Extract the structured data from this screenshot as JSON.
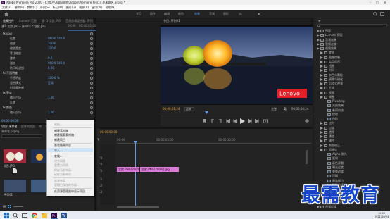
{
  "window": {
    "title": "Adobe Premiere Pro 2020 - C:\\用户\\Adm\\文档\\Adobe\\Premiere Pro\\14.0\\未命名.prproj *"
  },
  "menu": [
    "文件(F)",
    "编辑(E)",
    "剪辑(C)",
    "序列(S)",
    "标记(M)",
    "图形(G)",
    "视图(V)",
    "窗口(W)",
    "帮助(H)"
  ],
  "workspaces": [
    "学习",
    "组件",
    "编辑",
    "颜色",
    "效果",
    "音频",
    "图形",
    "库"
  ],
  "workspace_active": "效果",
  "effect_controls": {
    "tabs": [
      "效果控件",
      "Lumetri 范围",
      "源: 1-北欧.JPG",
      "音频剪辑混合器: 序列01"
    ],
    "clip": "源 * 北欧.JPG ▸ 序列01 * 北欧.JPG",
    "ruler": [
      "00:00",
      "00:00:05:00"
    ],
    "rows": [
      {
        "label": "fx 运动",
        "value": ""
      },
      {
        "label": "位置",
        "value": "960.0 540.0"
      },
      {
        "label": "缩放",
        "value": "100.0"
      },
      {
        "label": "缩放宽度",
        "value": "100.0"
      },
      {
        "label": "等比缩放",
        "value": ""
      },
      {
        "label": "旋转",
        "value": "0.0"
      },
      {
        "label": "锚点",
        "value": "960.0 540.0"
      },
      {
        "label": "防闪烁滤镜",
        "value": "0.00"
      },
      {
        "label": "fx 不透明度",
        "value": ""
      },
      {
        "label": "不透明度",
        "value": "100.0 %"
      },
      {
        "label": "混合模式",
        "value": "正常"
      },
      {
        "label": "时间重映射",
        "value": ""
      },
      {
        "label": "fx 亮度",
        "value": ""
      },
      {
        "label": "输入白场",
        "value": "1.00"
      },
      {
        "label": "反转",
        "value": ""
      },
      {
        "label": "fx 颜色",
        "value": ""
      },
      {
        "label": "输入白场",
        "value": "1.00"
      }
    ],
    "checkbox_label": "等比缩放",
    "timecode": "00:00:00:00"
  },
  "program_monitor": {
    "tab": "节目: 序列01",
    "brand": "Lenovo",
    "timecode_left": "00;00;01;24",
    "fit": "适合",
    "quality": "完整",
    "timecode_right": "00;00;04;24"
  },
  "project": {
    "tabs": [
      "项目: 未命名",
      "媒体浏览器",
      "库",
      "信息"
    ],
    "file": "未命名.prproj",
    "items": [
      "北欧.JPG",
      "序列01"
    ]
  },
  "context_menu": {
    "items": [
      {
        "label": "粘贴",
        "disabled": true
      },
      {
        "label": "新建素材箱",
        "disabled": false
      },
      {
        "label": "新建搜索素材箱",
        "disabled": false
      },
      {
        "label": "新建项目",
        "disabled": false
      },
      {
        "label": "查看隐藏内容",
        "disabled": false
      },
      {
        "label": "导入...",
        "disabled": false,
        "highlighted": true
      },
      {
        "label": "查找...",
        "disabled": false
      },
      {
        "label": "对齐网格",
        "disabled": true
      },
      {
        "label": "重置为网格",
        "disabled": true
      },
      {
        "label": "保存当前布局",
        "disabled": true
      },
      {
        "label": "另存为新布局...",
        "disabled": true
      },
      {
        "label": "恢复布局",
        "disabled": true
      },
      {
        "label": "管理已保存的布局...",
        "disabled": true
      },
      {
        "label": "在资源管理器中显示项目",
        "disabled": false
      }
    ]
  },
  "timeline": {
    "ruler": [
      "00:00",
      "00:00:05:00",
      "00:00:10:00"
    ],
    "timecode": "00:00:00:00",
    "clips": [
      "北欧.PNG[200%]",
      "北欧.PNG[200%].jpg"
    ],
    "tracks": [
      "V3",
      "V2",
      "V1",
      "A1",
      "A2",
      "A3"
    ]
  },
  "effects": {
    "tree": [
      {
        "label": "预设",
        "level": 0
      },
      {
        "label": "Lumetri 预设",
        "level": 0
      },
      {
        "label": "音频效果",
        "level": 0
      },
      {
        "label": "音频过渡",
        "level": 0
      },
      {
        "label": "视频效果",
        "level": 0
      },
      {
        "label": "变换",
        "level": 1
      },
      {
        "label": "图像控制",
        "level": 1
      },
      {
        "label": "实用程序",
        "level": 1
      },
      {
        "label": "扭曲",
        "level": 1
      },
      {
        "label": "时间",
        "level": 1
      },
      {
        "label": "杂色与颗粒",
        "level": 1
      },
      {
        "label": "模糊与锐化",
        "level": 1
      },
      {
        "label": "沉浸式视频",
        "level": 1
      },
      {
        "label": "生成",
        "level": 1
      },
      {
        "label": "视频",
        "level": 1
      },
      {
        "label": "调整",
        "level": 1
      },
      {
        "label": "ProcAmp",
        "level": 2
      },
      {
        "label": "光照效果",
        "level": 2
      },
      {
        "label": "卷积内核",
        "level": 2
      },
      {
        "label": "提取",
        "level": 2
      },
      {
        "label": "色阶",
        "level": 2
      },
      {
        "label": "过时",
        "level": 1
      },
      {
        "label": "过渡",
        "level": 1
      },
      {
        "label": "透视",
        "level": 1
      },
      {
        "label": "通道",
        "level": 1
      },
      {
        "label": "键控",
        "level": 1
      },
      {
        "label": "颜色校正",
        "level": 1
      },
      {
        "label": "风格化",
        "level": 1
      },
      {
        "label": "Alpha 发光",
        "level": 2
      },
      {
        "label": "复制",
        "level": 2
      },
      {
        "label": "彩色浮雕",
        "level": 2
      },
      {
        "label": "曝光过度",
        "level": 2
      },
      {
        "label": "查找边缘",
        "level": 2
      },
      {
        "label": "浮雕",
        "level": 2
      },
      {
        "label": "画笔描边",
        "level": 2
      },
      {
        "label": "粗糙边缘",
        "level": 2
      },
      {
        "label": "纹理",
        "level": 2
      },
      {
        "label": "色调分离",
        "level": 2
      },
      {
        "label": "闪光灯",
        "level": 2
      },
      {
        "label": "马赛克",
        "level": 2
      },
      {
        "label": "视频过渡",
        "level": 0
      }
    ]
  },
  "watermark": "最需教育",
  "taskbar": {
    "time": "19:05",
    "date": "2021/10/24"
  }
}
